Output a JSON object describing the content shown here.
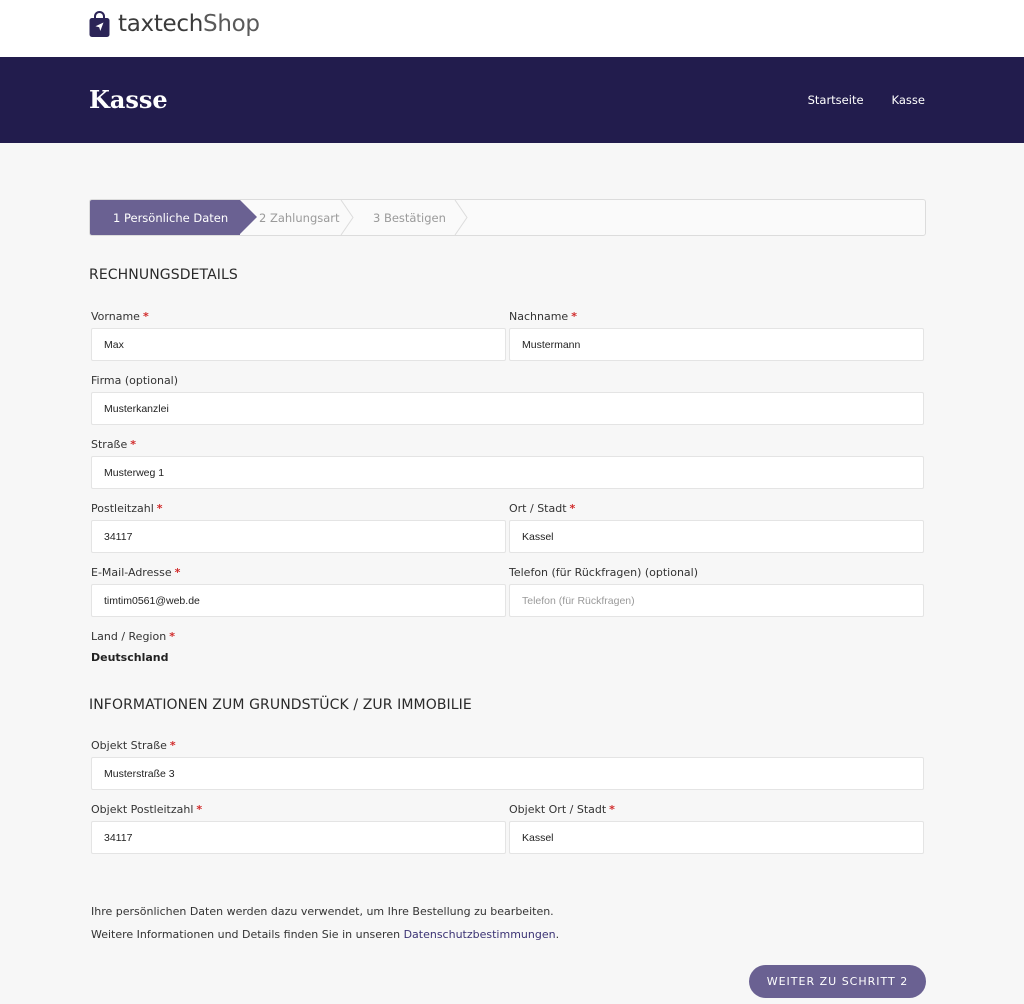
{
  "brand": {
    "part1": "taxtech",
    "part2": "Shop",
    "icon": "shopping-bag-icon"
  },
  "header": {
    "title": "Kasse",
    "nav": [
      "Startseite",
      "Kasse"
    ]
  },
  "stepper": {
    "steps": [
      "1 Persönliche Daten",
      "2 Zahlungsart",
      "3 Bestätigen"
    ],
    "active_index": 0
  },
  "billing": {
    "title": "RECHNUNGSDETAILS",
    "first_name": {
      "label": "Vorname",
      "required_mark": "*",
      "value": "Max"
    },
    "last_name": {
      "label": "Nachname",
      "required_mark": "*",
      "value": "Mustermann"
    },
    "company": {
      "label": "Firma (optional)",
      "value": "Musterkanzlei"
    },
    "street": {
      "label": "Straße",
      "required_mark": "*",
      "value": "Musterweg 1"
    },
    "zip": {
      "label": "Postleitzahl",
      "required_mark": "*",
      "value": "34117"
    },
    "city": {
      "label": "Ort / Stadt",
      "required_mark": "*",
      "value": "Kassel"
    },
    "email": {
      "label": "E-Mail-Adresse",
      "required_mark": "*",
      "value": "timtim0561@web.de"
    },
    "phone": {
      "label": "Telefon (für Rückfragen) (optional)",
      "value": "",
      "placeholder": "Telefon (für Rückfragen)"
    },
    "country": {
      "label": "Land / Region",
      "required_mark": "*",
      "value": "Deutschland"
    }
  },
  "property": {
    "title": "INFORMATIONEN ZUM GRUNDSTÜCK / ZUR IMMOBILIE",
    "street": {
      "label": "Objekt Straße",
      "required_mark": "*",
      "value": "Musterstraße 3"
    },
    "zip": {
      "label": "Objekt Postleitzahl",
      "required_mark": "*",
      "value": "34117"
    },
    "city": {
      "label": "Objekt Ort / Stadt",
      "required_mark": "*",
      "value": "Kassel"
    }
  },
  "privacy": {
    "line1": "Ihre persönlichen Daten werden dazu verwendet, um Ihre Bestellung zu bearbeiten.",
    "line2_prefix": "Weitere Informationen und Details finden Sie in unseren ",
    "link": "Datenschutzbestimmungen",
    "line2_suffix": "."
  },
  "next_button": "WEITER ZU SCHRITT 2",
  "colors": {
    "header_bg": "#221c4d",
    "accent": "#6a6192",
    "required": "#d12b2b",
    "link": "#3b3374"
  }
}
